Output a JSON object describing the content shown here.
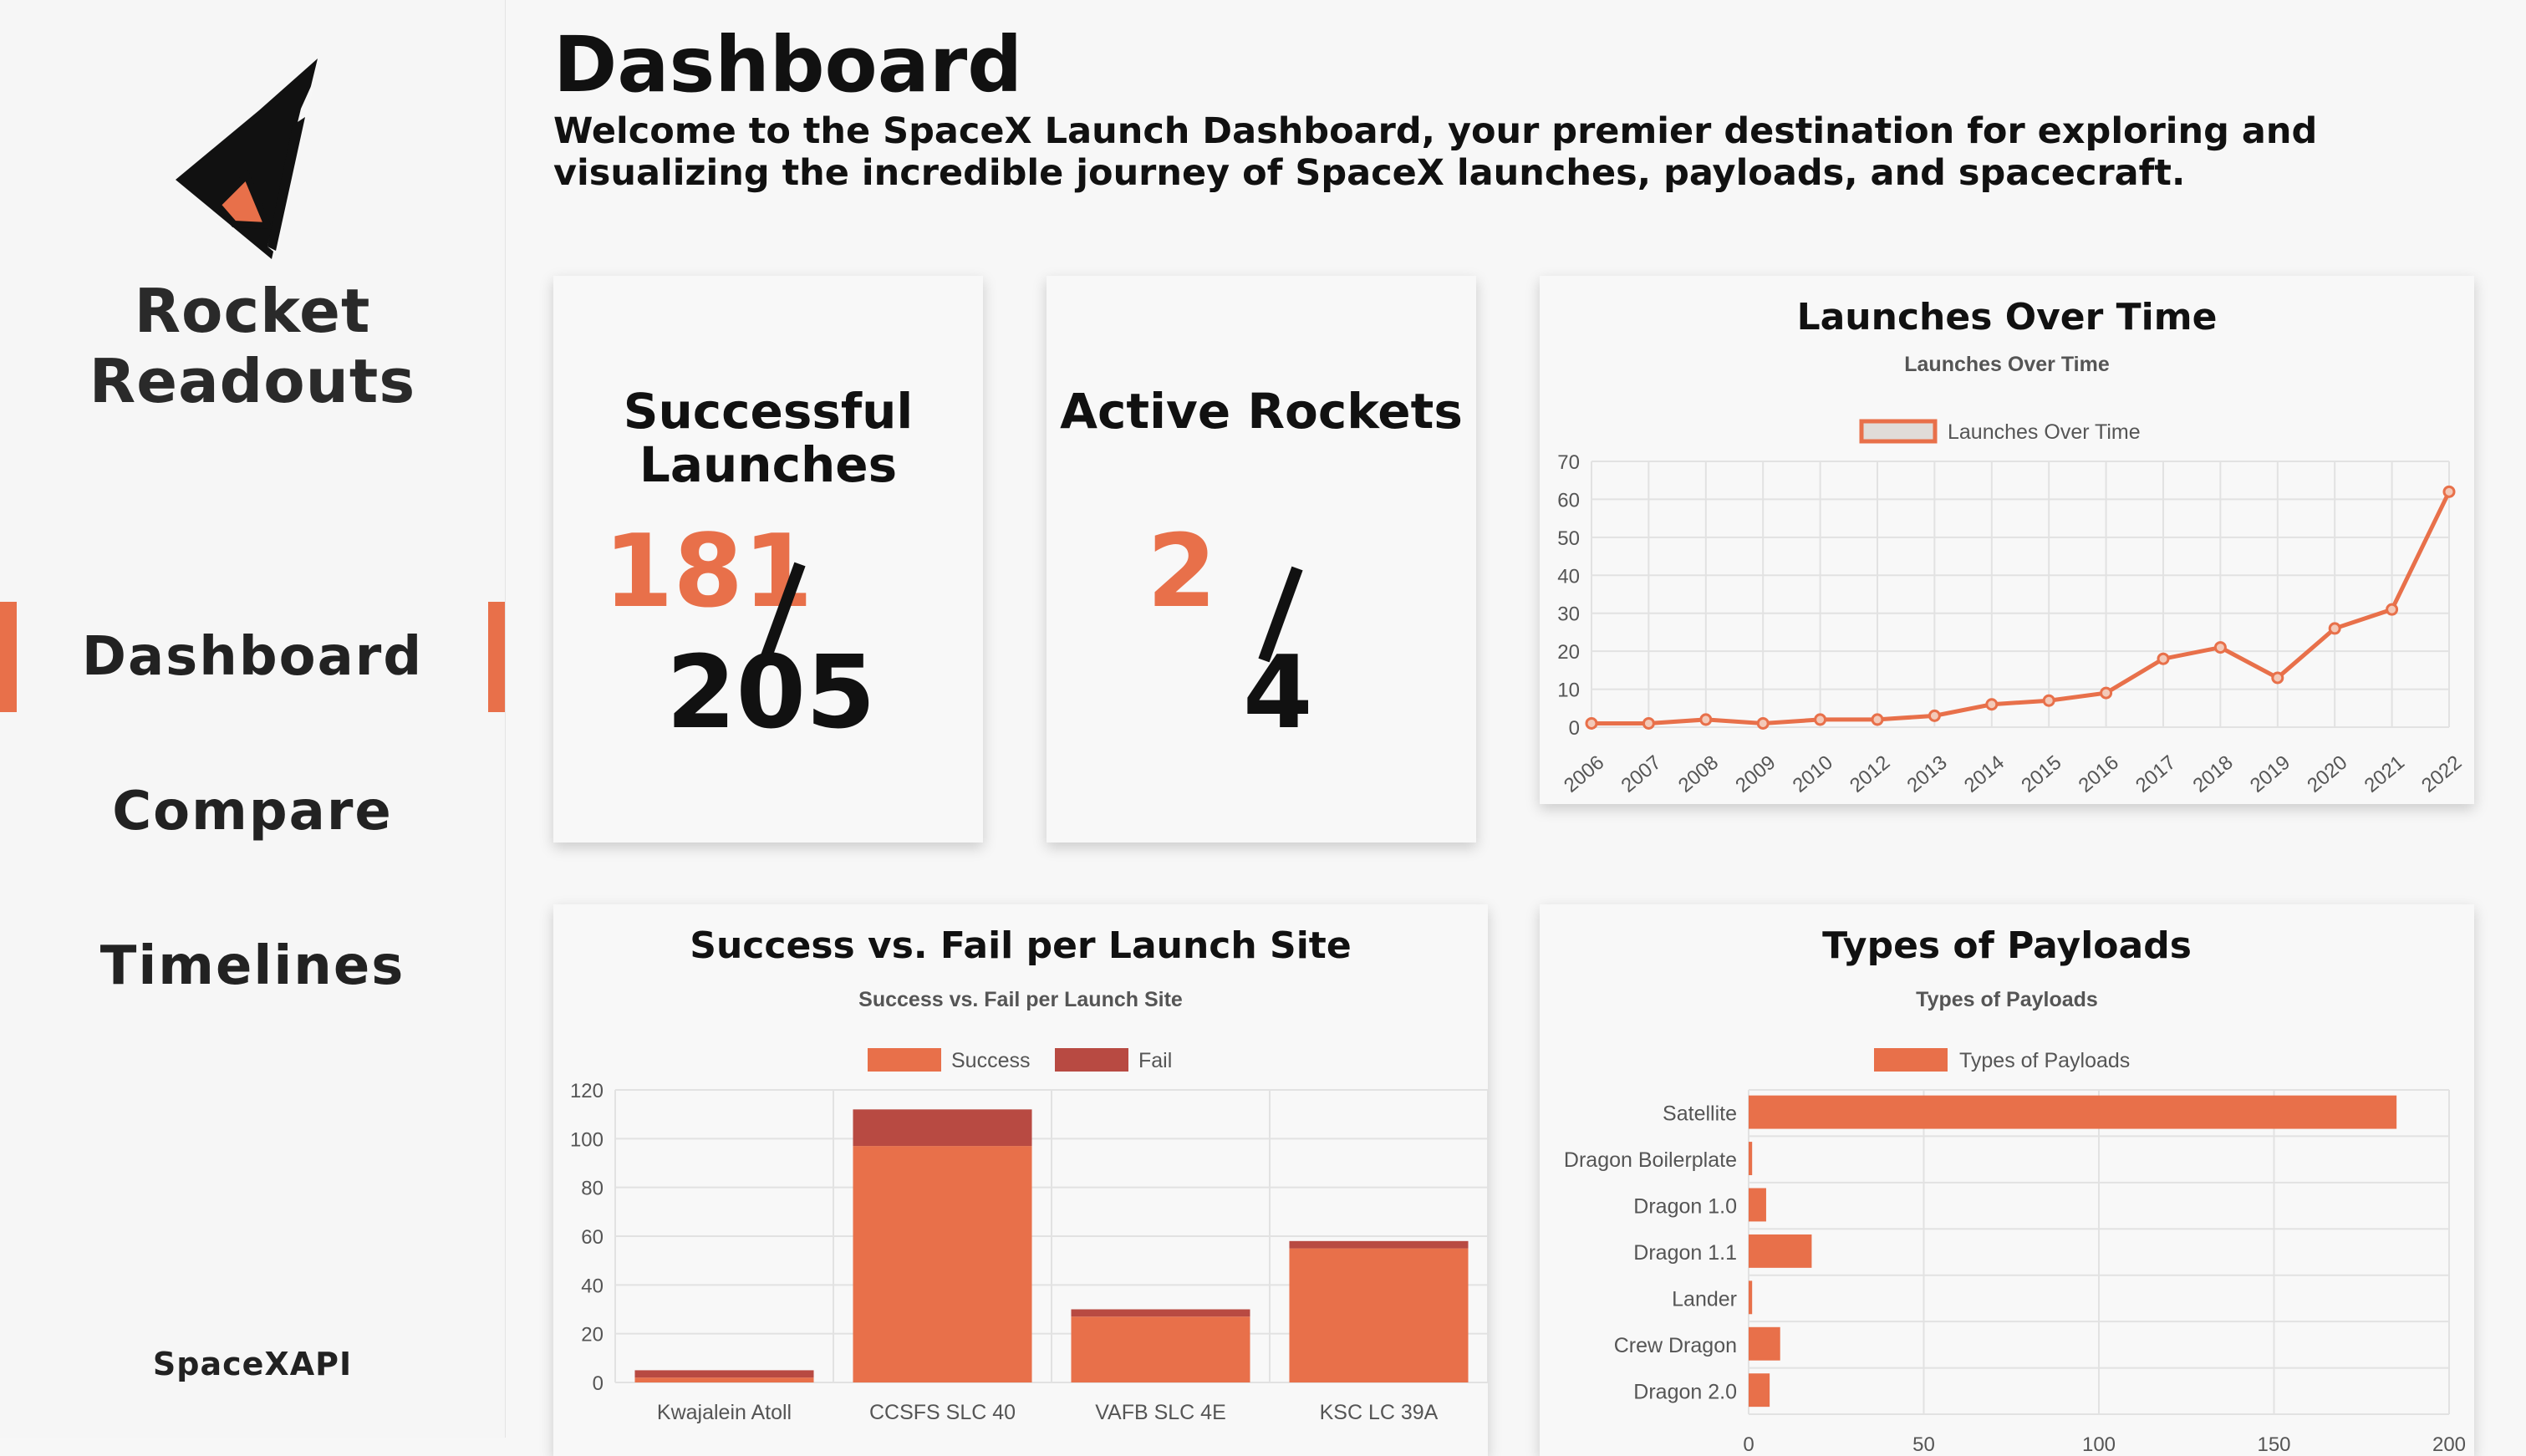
{
  "app": {
    "name": "Rocket Readouts",
    "footer": "SpaceXAPI"
  },
  "nav": {
    "items": [
      {
        "label": "Dashboard",
        "active": true
      },
      {
        "label": "Compare",
        "active": false
      },
      {
        "label": "Timelines",
        "active": false
      }
    ]
  },
  "header": {
    "title": "Dashboard",
    "intro": "Welcome to the SpaceX Launch Dashboard, your premier destination for exploring and visualizing the incredible journey of SpaceX launches, payloads, and spacecraft."
  },
  "stats": {
    "launches": {
      "title": "Successful Launches",
      "numerator": "181",
      "denominator": "205"
    },
    "rockets": {
      "title": "Active Rockets",
      "numerator": "2",
      "denominator": "4"
    }
  },
  "colors": {
    "accent": "#e8704a",
    "fail": "#b84a42",
    "text": "#111111"
  },
  "chart_data": [
    {
      "type": "line",
      "card_title": "Launches Over Time",
      "title": "Launches Over Time",
      "categories": [
        "2006",
        "2007",
        "2008",
        "2009",
        "2010",
        "2012",
        "2013",
        "2014",
        "2015",
        "2016",
        "2017",
        "2018",
        "2019",
        "2020",
        "2021",
        "2022"
      ],
      "series": [
        {
          "name": "Launches Over Time",
          "values": [
            1,
            1,
            2,
            1,
            2,
            2,
            3,
            6,
            7,
            9,
            18,
            21,
            13,
            26,
            31,
            62
          ]
        }
      ],
      "ylim": [
        0,
        70
      ],
      "yticks": [
        0,
        10,
        20,
        30,
        40,
        50,
        60,
        70
      ],
      "grid": true,
      "legend": "top"
    },
    {
      "type": "bar",
      "stacked": true,
      "card_title": "Success vs. Fail per Launch Site",
      "title": "Success vs. Fail per Launch Site",
      "categories": [
        "Kwajalein Atoll",
        "CCSFS SLC 40",
        "VAFB SLC 4E",
        "KSC LC 39A"
      ],
      "series": [
        {
          "name": "Success",
          "values": [
            2,
            97,
            27,
            55
          ]
        },
        {
          "name": "Fail",
          "values": [
            3,
            15,
            3,
            3
          ]
        }
      ],
      "ylim": [
        0,
        120
      ],
      "yticks": [
        0,
        20,
        40,
        60,
        80,
        100,
        120
      ],
      "grid": true,
      "legend": "top"
    },
    {
      "type": "bar",
      "orientation": "horizontal",
      "card_title": "Types of Payloads",
      "title": "Types of Payloads",
      "categories": [
        "Satellite",
        "Dragon Boilerplate",
        "Dragon 1.0",
        "Dragon 1.1",
        "Lander",
        "Crew Dragon",
        "Dragon 2.0"
      ],
      "series": [
        {
          "name": "Types of Payloads",
          "values": [
            185,
            1,
            5,
            18,
            1,
            9,
            6
          ]
        }
      ],
      "xlim": [
        0,
        200
      ],
      "xticks": [
        0,
        50,
        100,
        150,
        200
      ],
      "grid": true,
      "legend": "top"
    }
  ]
}
